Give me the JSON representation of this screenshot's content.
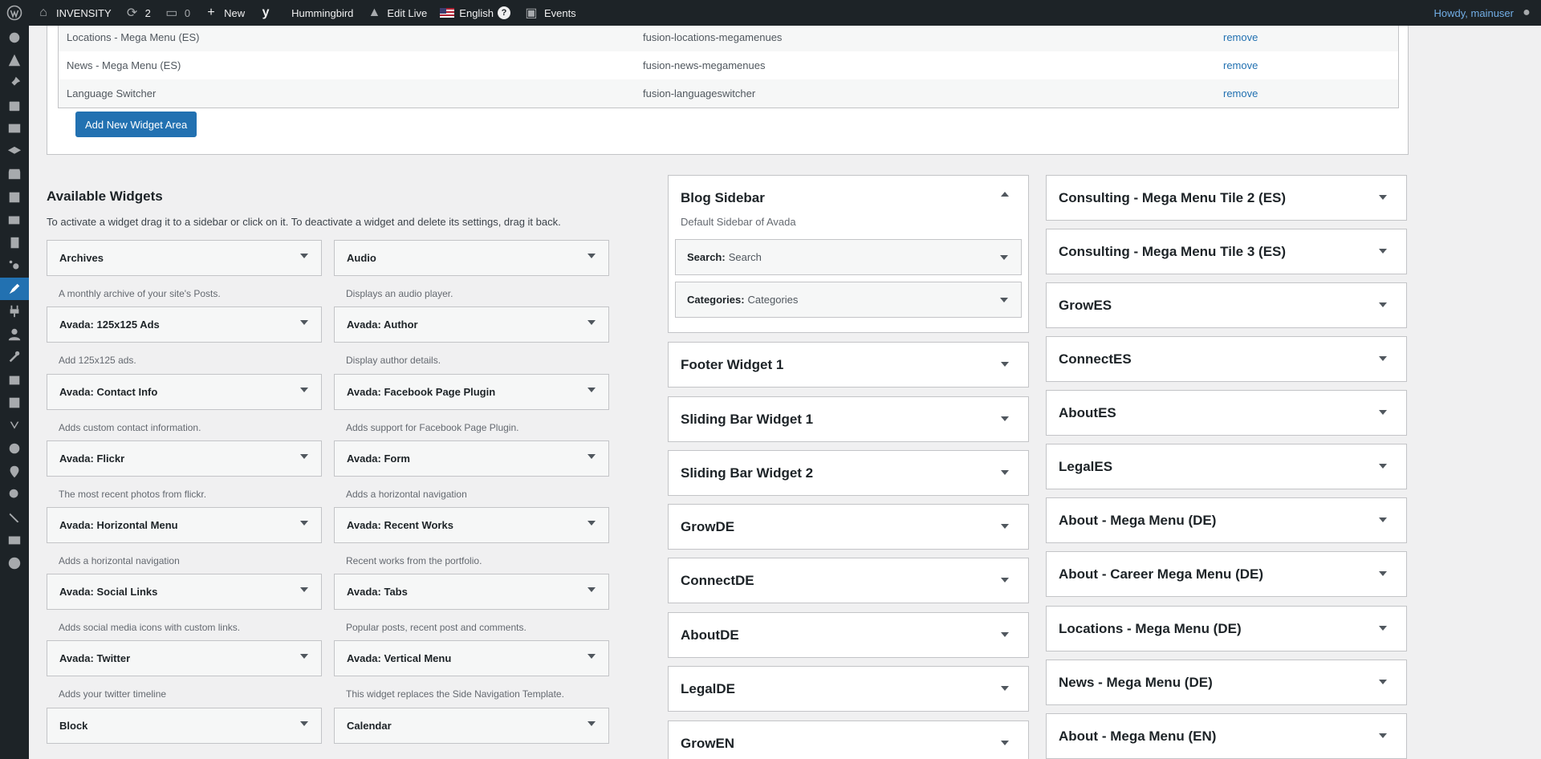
{
  "admin_bar": {
    "site_name": "INVENSITY",
    "updates_count": "2",
    "comments_count": "0",
    "new_label": "New",
    "hummingbird_label": "Hummingbird",
    "edit_live_label": "Edit Live",
    "language_label": "English",
    "help_label": "?",
    "events_label": "Events",
    "greeting": "Howdy, mainuser"
  },
  "widget_areas": [
    {
      "name": "Locations - Mega Menu (ES)",
      "class": "fusion-locations-megamenues",
      "action": "remove"
    },
    {
      "name": "News - Mega Menu (ES)",
      "class": "fusion-news-megamenues",
      "action": "remove"
    },
    {
      "name": "Language Switcher",
      "class": "fusion-languageswitcher",
      "action": "remove"
    }
  ],
  "add_area_button": "Add New Widget Area",
  "available": {
    "title": "Available Widgets",
    "description": "To activate a widget drag it to a sidebar or click on it. To deactivate a widget and delete its settings, drag it back.",
    "widgets": [
      {
        "name": "Archives",
        "desc": "A monthly archive of your site's Posts."
      },
      {
        "name": "Audio",
        "desc": "Displays an audio player."
      },
      {
        "name": "Avada: 125x125 Ads",
        "desc": "Add 125x125 ads."
      },
      {
        "name": "Avada: Author",
        "desc": "Display author details."
      },
      {
        "name": "Avada: Contact Info",
        "desc": "Adds custom contact information."
      },
      {
        "name": "Avada: Facebook Page Plugin",
        "desc": "Adds support for Facebook Page Plugin."
      },
      {
        "name": "Avada: Flickr",
        "desc": "The most recent photos from flickr."
      },
      {
        "name": "Avada: Form",
        "desc": "Adds a horizontal navigation"
      },
      {
        "name": "Avada: Horizontal Menu",
        "desc": "Adds a horizontal navigation"
      },
      {
        "name": "Avada: Recent Works",
        "desc": "Recent works from the portfolio."
      },
      {
        "name": "Avada: Social Links",
        "desc": "Adds social media icons with custom links."
      },
      {
        "name": "Avada: Tabs",
        "desc": "Popular posts, recent post and comments."
      },
      {
        "name": "Avada: Twitter",
        "desc": "Adds your twitter timeline"
      },
      {
        "name": "Avada: Vertical Menu",
        "desc": "This widget replaces the Side Navigation Template."
      },
      {
        "name": "Block",
        "desc": ""
      },
      {
        "name": "Calendar",
        "desc": ""
      }
    ]
  },
  "blog_sidebar": {
    "title": "Blog Sidebar",
    "description": "Default Sidebar of Avada",
    "items": [
      {
        "type": "Search:",
        "title": "Search"
      },
      {
        "type": "Categories:",
        "title": "Categories"
      }
    ]
  },
  "sidebars_col1": [
    "Footer Widget 1",
    "Sliding Bar Widget 1",
    "Sliding Bar Widget 2",
    "GrowDE",
    "ConnectDE",
    "AboutDE",
    "LegalDE",
    "GrowEN"
  ],
  "sidebars_col2": [
    "Consulting - Mega Menu Tile 2 (ES)",
    "Consulting - Mega Menu Tile 3 (ES)",
    "GrowES",
    "ConnectES",
    "AboutES",
    "LegalES",
    "About - Mega Menu (DE)",
    "About - Career Mega Menu (DE)",
    "Locations - Mega Menu (DE)",
    "News - Mega Menu (DE)",
    "About - Mega Menu (EN)"
  ]
}
